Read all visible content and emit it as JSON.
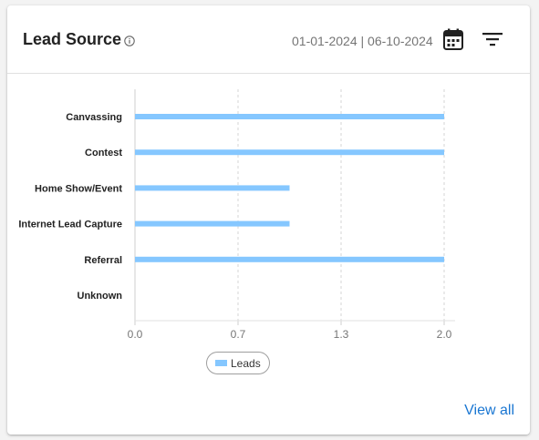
{
  "card": {
    "title": "Lead Source",
    "date_range": "01-01-2024 | 06-10-2024",
    "view_all_label": "View all"
  },
  "icons": {
    "info": "info-icon",
    "calendar": "calendar-icon",
    "filter": "filter-icon"
  },
  "colors": {
    "bar": "#85c7ff",
    "link": "#1976d2"
  },
  "chart_data": {
    "type": "bar",
    "orientation": "horizontal",
    "categories": [
      "Canvassing",
      "Contest",
      "Home Show/Event",
      "Internet Lead Capture",
      "Referral",
      "Unknown"
    ],
    "series": [
      {
        "name": "Leads",
        "values": [
          2,
          2,
          1,
          1,
          2,
          0
        ]
      }
    ],
    "xlim": [
      0,
      2
    ],
    "xticks": [
      "0.0",
      "0.7",
      "1.3",
      "2.0"
    ],
    "xtick_values": [
      0,
      0.6667,
      1.3333,
      2
    ],
    "grid": "vertical-dashed",
    "legend_position": "bottom"
  }
}
